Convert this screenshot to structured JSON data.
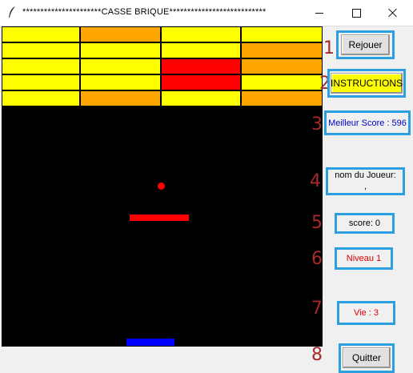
{
  "window": {
    "title": "**********************CASSE BRIQUE***************************"
  },
  "panel": {
    "numbers": [
      "1",
      "2",
      "3",
      "4",
      "5",
      "6",
      "7",
      "8"
    ],
    "replay_label": "Rejouer",
    "instructions_label": "INSTRUCTIONS",
    "best_score": "Meilleur Score : 596",
    "player_line1": "nom du Joueur:",
    "player_line2": ",",
    "score": "score: 0",
    "level": "Niveau 1",
    "lives": "Vie : 3",
    "quit_label": "Quitter"
  },
  "colors": {
    "yellow": "#ffff00",
    "orange": "#ffa500",
    "red": "#ff0000",
    "paddle": "#0000ff",
    "frame": "#2b9fe0",
    "score_blue": "#0000cc",
    "level_red": "#e00000"
  },
  "bricks": [
    [
      "yellow",
      "orange",
      "yellow",
      "yellow"
    ],
    [
      "yellow",
      "yellow",
      "yellow",
      "orange"
    ],
    [
      "yellow",
      "yellow",
      "red",
      "orange"
    ],
    [
      "yellow",
      "yellow",
      "red",
      "yellow"
    ],
    [
      "yellow",
      "orange",
      "yellow",
      "orange"
    ]
  ]
}
